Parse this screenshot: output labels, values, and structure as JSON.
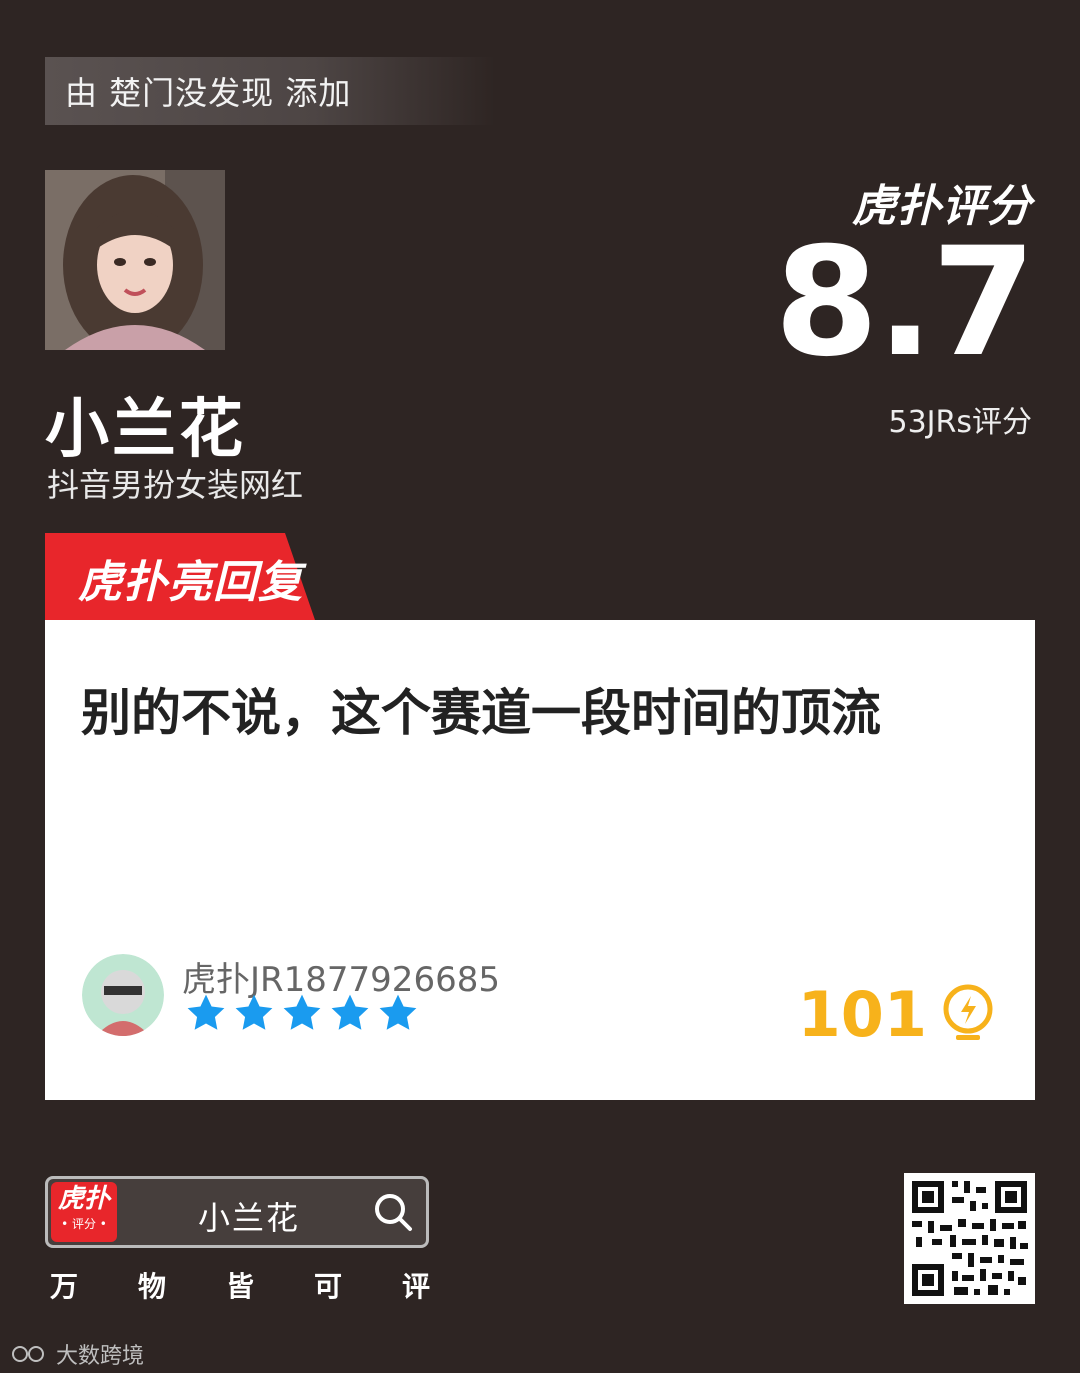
{
  "header": {
    "added_by_text": "由 楚门没发现 添加"
  },
  "subject": {
    "name": "小兰花",
    "description": "抖音男扮女装网红"
  },
  "score": {
    "brand": "虎扑评分",
    "value": "8.7",
    "count_text": "53JRs评分"
  },
  "highlight": {
    "tab_label": "虎扑亮回复",
    "tab_color": "#e8262b",
    "comment_text": "别的不说，这个赛道一段时间的顶流",
    "user_name": "虎扑JR1877926685",
    "rating_stars": 5,
    "star_color": "#1a9bef",
    "likes": "101",
    "likes_color": "#f7b21b"
  },
  "footer": {
    "app_logo_main": "虎扑",
    "app_logo_sub": "• 评分 •",
    "search_text": "小兰花",
    "slogan": [
      "万",
      "物",
      "皆",
      "可",
      "评"
    ],
    "watermark": "大数跨境"
  },
  "icons": {
    "star": "star-icon",
    "light": "lightbulb-icon",
    "search": "search-icon",
    "qr": "qr-code-icon"
  }
}
